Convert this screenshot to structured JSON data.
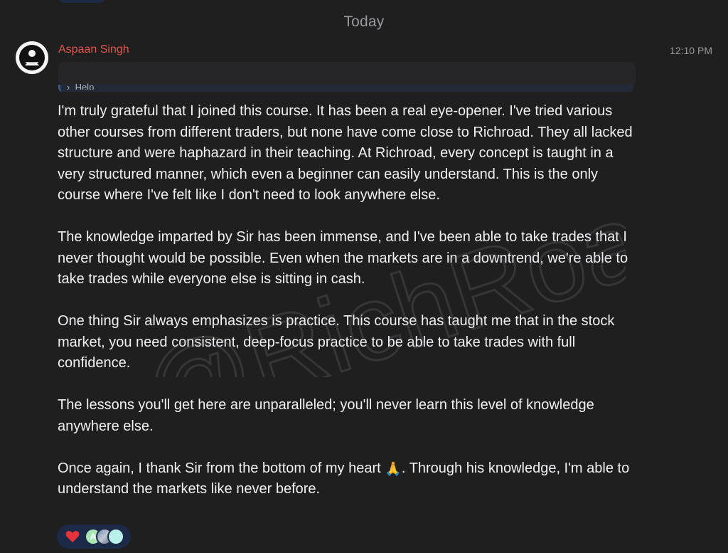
{
  "divider": {
    "label": "Today"
  },
  "message": {
    "sender": "Aspaan Singh",
    "time": "12:10 PM",
    "reply_preview": "Help",
    "paragraphs": [
      "I'm truly grateful that I joined this course. It has been a real eye-opener. I've tried various other courses from different traders, but none have come close to Richroad. They all lacked structure and were haphazard in their teaching. At Richroad, every concept is taught in a very structured manner, which even a beginner can easily understand. This is the only course where I've felt like I don't need to look anywhere else.",
      "The knowledge imparted by Sir has been immense, and I've been able to take trades that I never thought would be possible. Even when the markets are in a downtrend, we're able to take trades while everyone else is sitting in cash.",
      "One thing Sir always emphasizes is practice. This course has taught me that in the stock market, you need consistent, deep-focus practice to be able to take trades with full confidence.",
      "The lessons you'll get here are unparalleled; you'll never learn this level of knowledge anywhere else."
    ],
    "closing_before_emoji": "Once again, I thank Sir from the bottom of my heart ",
    "closing_emoji": "🙏",
    "closing_after_emoji": ". Through his knowledge, I'm able to understand the markets like never before."
  },
  "watermark": {
    "text": "@RichRoad"
  },
  "reactions": {
    "emoji_icon": "heart-icon",
    "reactor_initial": "A",
    "colors": {
      "heart": "#e8323c",
      "bar": "#1c2a47",
      "reactor_a": "#a9e6b4",
      "reactor_c": "#b9f0e9"
    }
  },
  "colors": {
    "background": "#1f1f20",
    "sender": "#e0564c",
    "text": "#f1f1f3",
    "muted": "#9a9a9e"
  }
}
